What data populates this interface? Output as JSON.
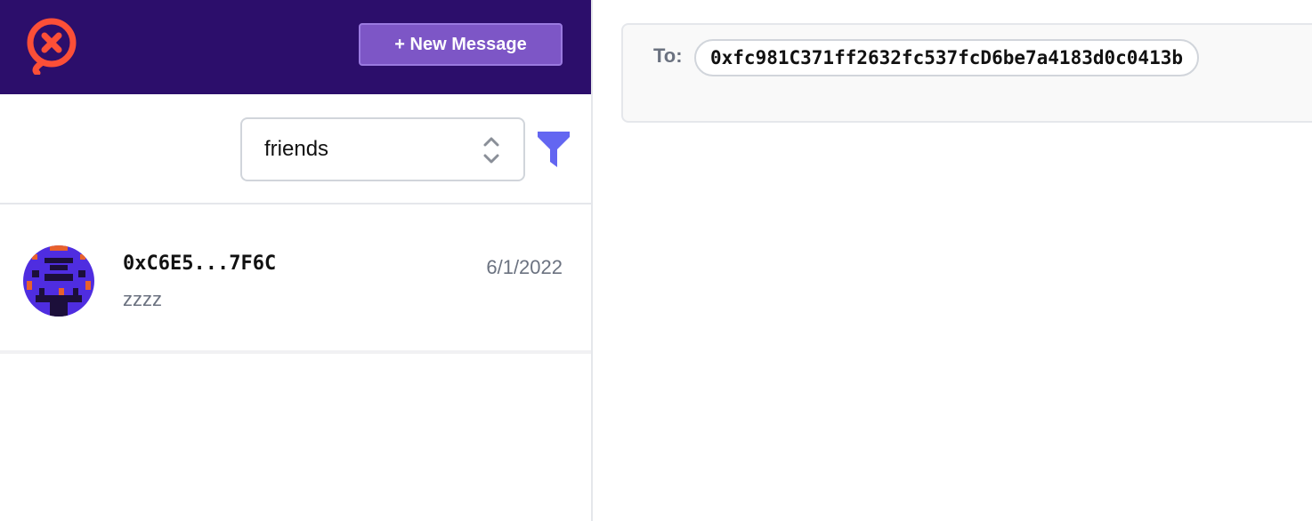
{
  "header": {
    "logo_icon": "xmtp-logo-icon",
    "new_message_label": "+ New Message",
    "brand_color": "#2c0e6b",
    "button_color": "#7d56c6"
  },
  "filter": {
    "selected": "friends",
    "filter_icon": "funnel-icon",
    "filter_icon_color": "#6366f1"
  },
  "conversations": [
    {
      "address": "0xC6E5...7F6C",
      "preview": "zzzz",
      "date": "6/1/2022",
      "avatar_icon": "pixel-avatar-icon"
    }
  ],
  "recipient": {
    "to_label": "To:",
    "address": "0xfc981C371ff2632fc537fcD6be7a4183d0c0413b"
  }
}
